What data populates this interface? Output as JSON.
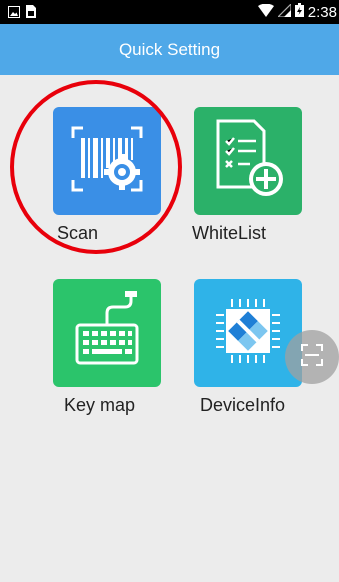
{
  "status_bar": {
    "time": "2:38",
    "left_icons": [
      "image-icon",
      "sim-icon"
    ],
    "right_icons": [
      "wifi-icon",
      "signal-icon",
      "battery-icon"
    ]
  },
  "app_bar": {
    "title": "Quick Setting"
  },
  "tiles": [
    {
      "label": "Scan",
      "icon": "barcode-gear-icon",
      "color": "#3a8fe6"
    },
    {
      "label": "WhiteList",
      "icon": "checklist-add-icon",
      "color": "#2bb169"
    },
    {
      "label": "Key map",
      "icon": "keyboard-icon",
      "color": "#2bc46b"
    },
    {
      "label": "DeviceInfo",
      "icon": "chip-icon",
      "color": "#2fb3e8"
    }
  ],
  "annotation": {
    "highlight_color": "#e8000b"
  },
  "floating_button": {
    "icon": "scan-frame-icon"
  }
}
